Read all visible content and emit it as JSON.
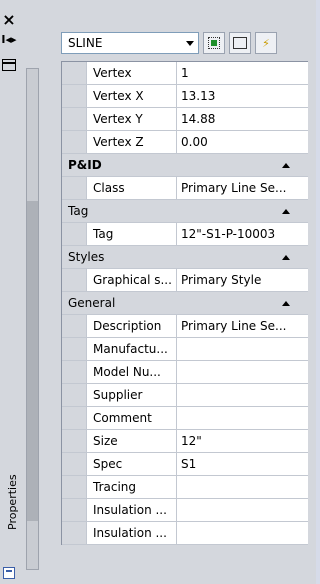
{
  "window": {
    "close_glyph": "×",
    "autohide_glyph": "I◂▸",
    "vertical_title": "Properties"
  },
  "toolbar": {
    "object_type": "SLINE"
  },
  "rows": [
    {
      "type": "prop",
      "name": "Vertex",
      "value": "1"
    },
    {
      "type": "prop",
      "name": "Vertex X",
      "value": "13.13"
    },
    {
      "type": "prop",
      "name": "Vertex Y",
      "value": "14.88"
    },
    {
      "type": "prop",
      "name": "Vertex Z",
      "value": "0.00"
    },
    {
      "type": "cat",
      "label": "P&ID",
      "bold": true
    },
    {
      "type": "prop",
      "name": "Class",
      "value": "Primary Line Se..."
    },
    {
      "type": "cat",
      "label": "Tag",
      "bold": false
    },
    {
      "type": "prop",
      "name": "Tag",
      "value": "12\"-S1-P-10003"
    },
    {
      "type": "cat",
      "label": "Styles",
      "bold": false
    },
    {
      "type": "prop",
      "name": "Graphical s...",
      "value": "Primary Style"
    },
    {
      "type": "cat",
      "label": "General",
      "bold": false
    },
    {
      "type": "prop",
      "name": "Description",
      "value": "Primary Line Se..."
    },
    {
      "type": "prop",
      "name": "Manufactu...",
      "value": ""
    },
    {
      "type": "prop",
      "name": "Model Nu...",
      "value": ""
    },
    {
      "type": "prop",
      "name": "Supplier",
      "value": ""
    },
    {
      "type": "prop",
      "name": "Comment",
      "value": ""
    },
    {
      "type": "prop",
      "name": "Size",
      "value": "12\""
    },
    {
      "type": "prop",
      "name": "Spec",
      "value": "S1"
    },
    {
      "type": "prop",
      "name": "Tracing",
      "value": ""
    },
    {
      "type": "prop",
      "name": "Insulation ...",
      "value": ""
    },
    {
      "type": "prop",
      "name": "Insulation ...",
      "value": ""
    }
  ]
}
